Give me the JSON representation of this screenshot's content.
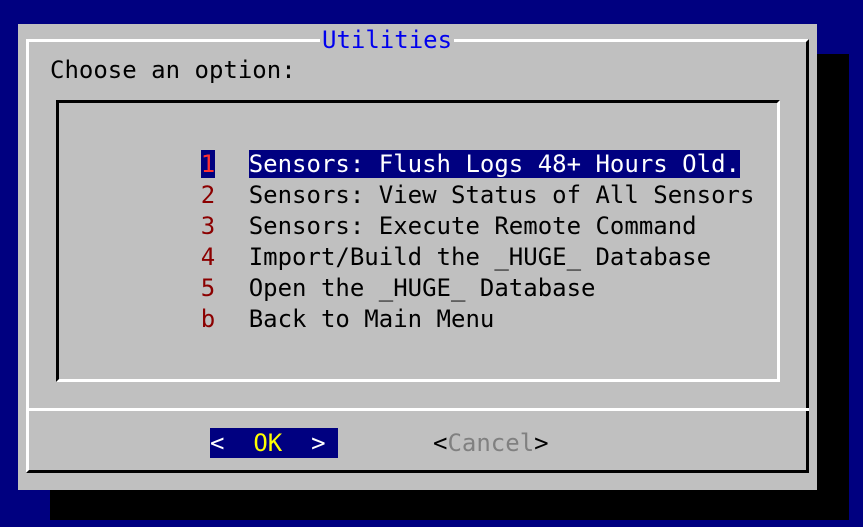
{
  "dialog": {
    "title": "Utilities",
    "prompt": "Choose an option:"
  },
  "menu": {
    "items": [
      {
        "key": "1",
        "label": "Sensors: Flush Logs 48+ Hours Old.",
        "selected": true
      },
      {
        "key": "2",
        "label": "Sensors: View Status of All Sensors",
        "selected": false
      },
      {
        "key": "3",
        "label": "Sensors: Execute Remote Command",
        "selected": false
      },
      {
        "key": "4",
        "label": "Import/Build the _HUGE_ Database",
        "selected": false
      },
      {
        "key": "5",
        "label": "Open the _HUGE_ Database",
        "selected": false
      },
      {
        "key": "b",
        "label": "Back to Main Menu",
        "selected": false
      }
    ]
  },
  "buttons": {
    "ok": {
      "left": "<",
      "label": "OK",
      "right": ">"
    },
    "cancel": {
      "left": "<",
      "label": "Cancel",
      "right": ">"
    }
  },
  "colors": {
    "background": "#000080",
    "dialog": "#c0c0c0",
    "title": "#0000ee",
    "hotkey": "#8b0000",
    "selection": "#000080",
    "ok_text": "#ffff00"
  }
}
